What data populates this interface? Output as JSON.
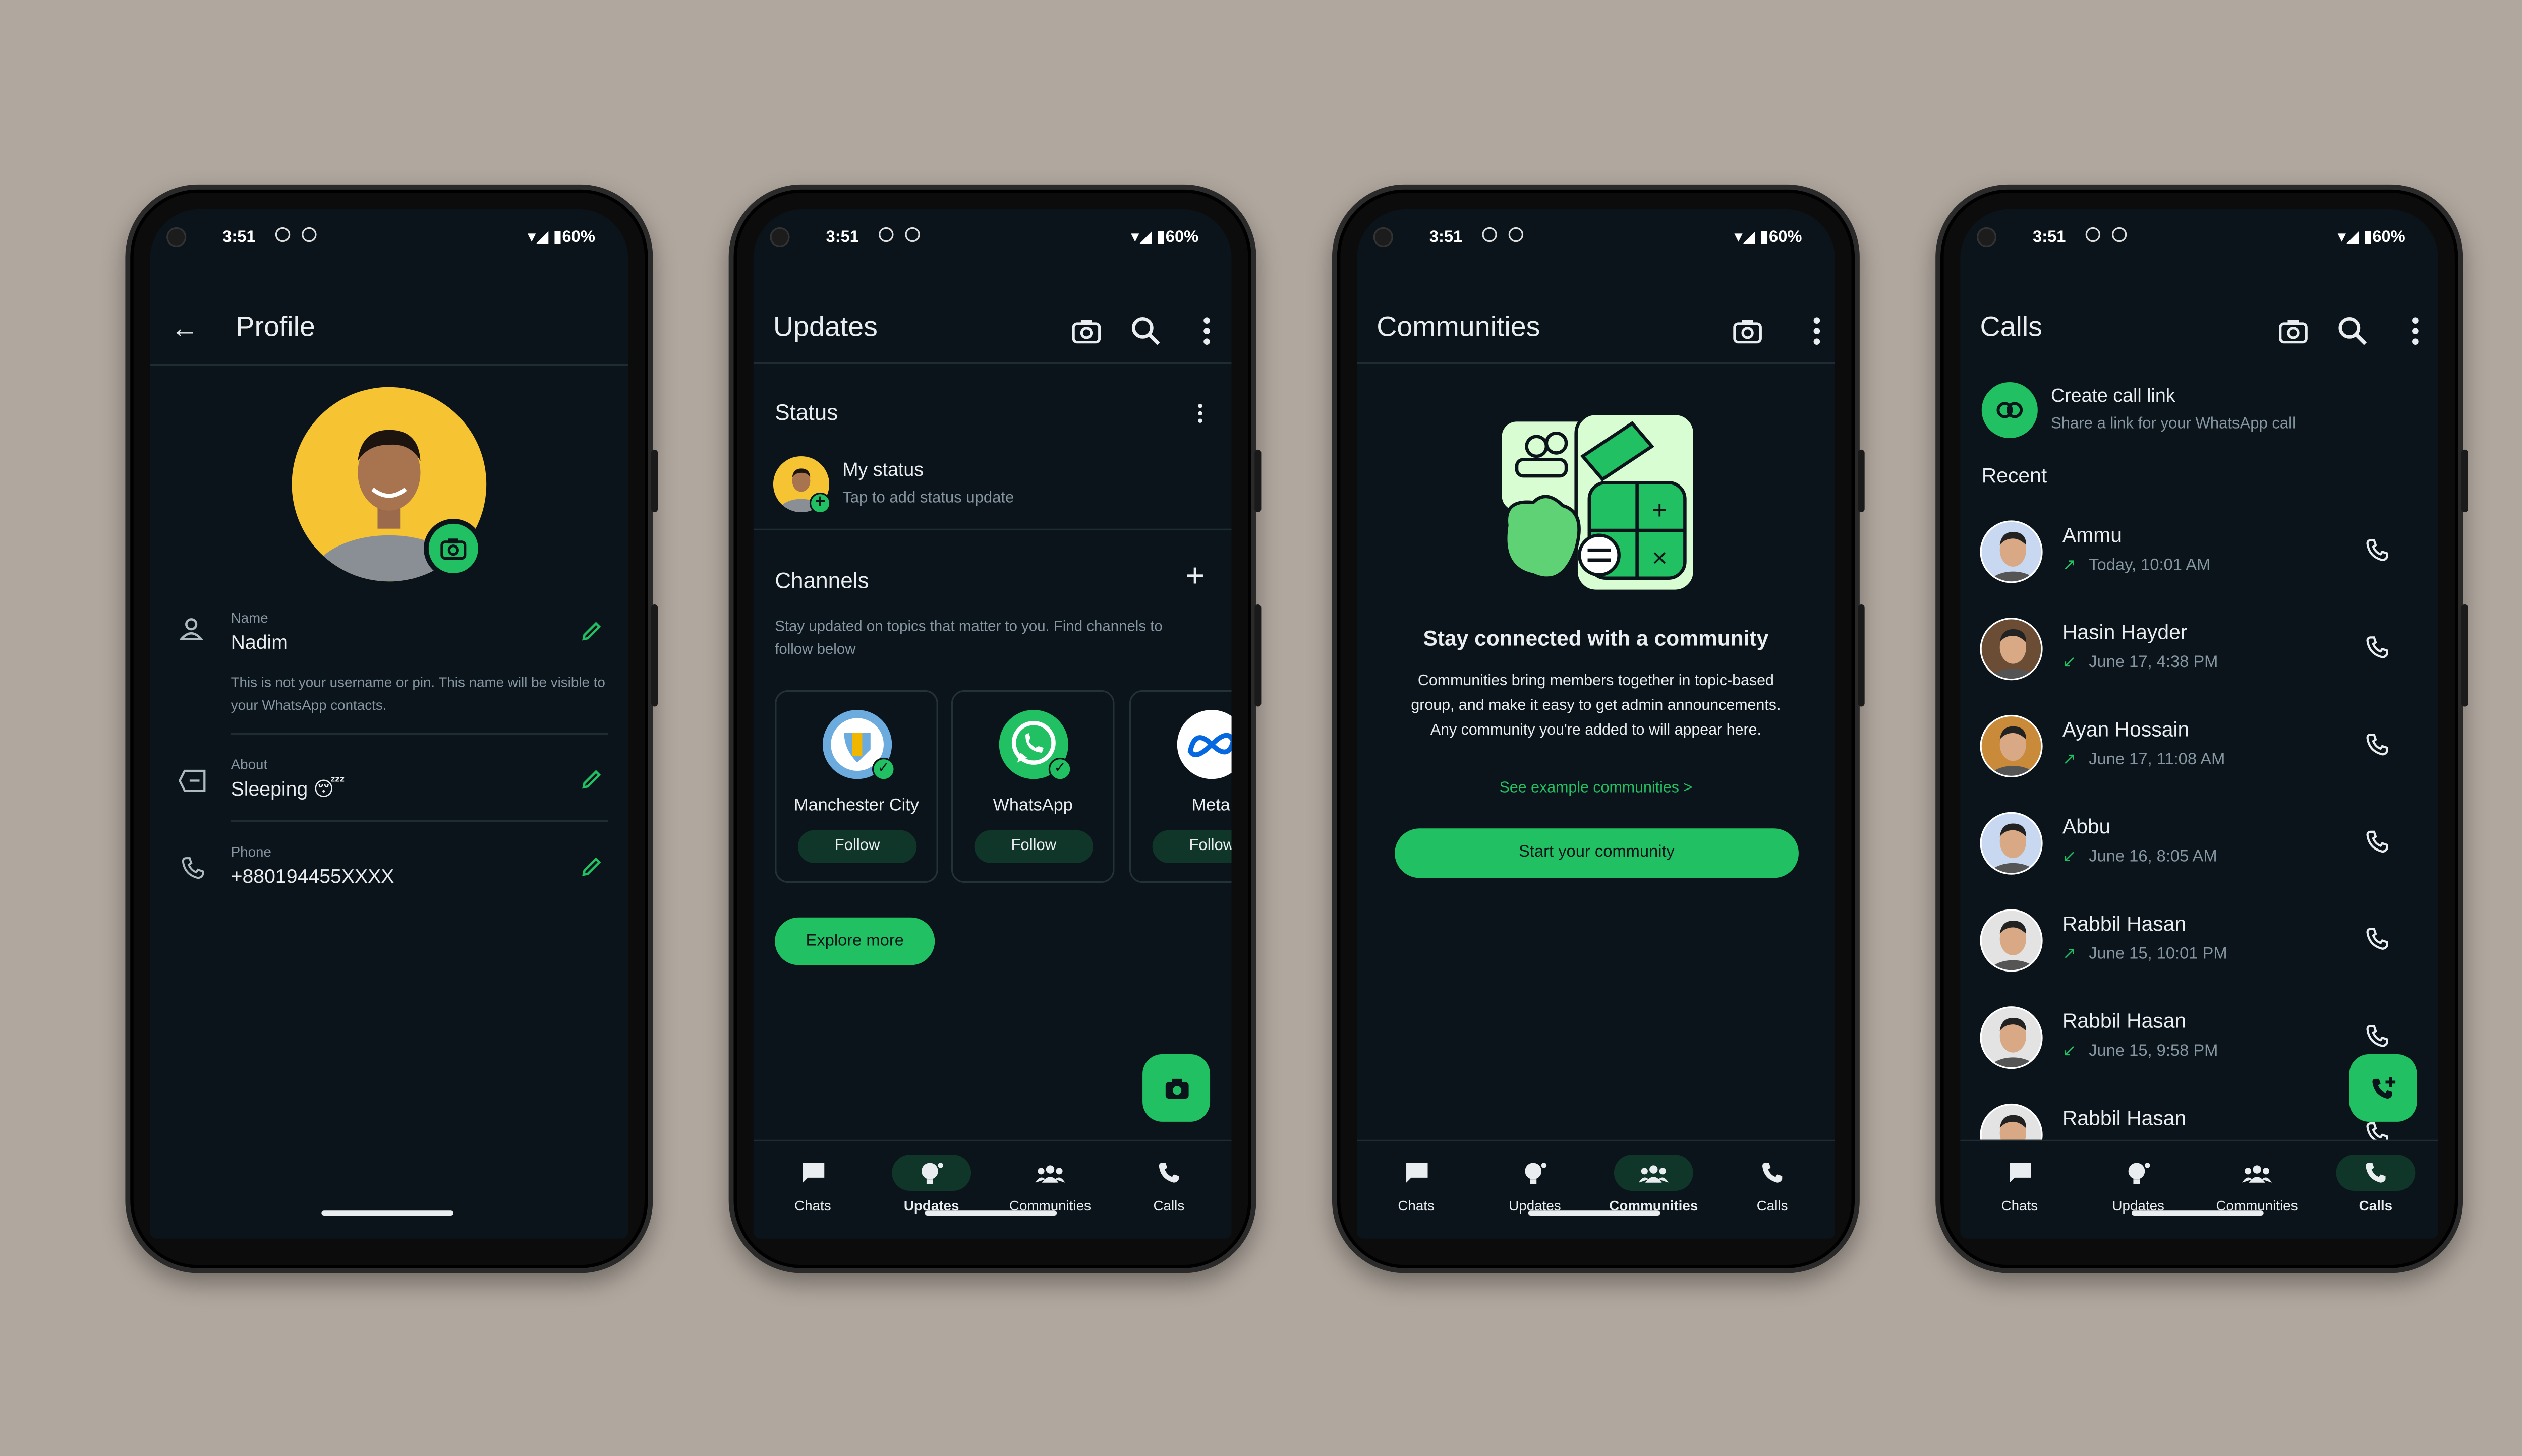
{
  "status": {
    "time": "3:51",
    "battery": "60%"
  },
  "nav": [
    {
      "label": "Chats",
      "icon": "chat-icon"
    },
    {
      "label": "Updates",
      "icon": "updates-icon"
    },
    {
      "label": "Communities",
      "icon": "communities-icon"
    },
    {
      "label": "Calls",
      "icon": "phone-icon"
    }
  ],
  "profile": {
    "title": "Profile",
    "name_label": "Name",
    "name_value": "Nadim",
    "name_hint": "This is not your username or pin. This name will be visible to your WhatsApp contacts.",
    "about_label": "About",
    "about_value": "Sleeping 😴",
    "phone_label": "Phone",
    "phone_value": "+880194455XXXX"
  },
  "updates": {
    "title": "Updates",
    "status_heading": "Status",
    "my_status": "My status",
    "my_status_sub": "Tap to add status update",
    "channels_heading": "Channels",
    "channels_desc": "Stay updated on topics that matter to you. Find channels to follow below",
    "channels": [
      {
        "name": "Manchester City",
        "follow": "Follow"
      },
      {
        "name": "WhatsApp",
        "follow": "Follow"
      },
      {
        "name": "Meta",
        "follow": "Follow"
      }
    ],
    "explore": "Explore more"
  },
  "communities": {
    "title": "Communities",
    "heading": "Stay connected with a community",
    "desc": "Communities bring members together in topic-based group, and make it easy to get admin announcements. Any community you're added to will appear here.",
    "link": "See example communities >",
    "button": "Start your community"
  },
  "calls": {
    "title": "Calls",
    "create_title": "Create call link",
    "create_sub": "Share a link for your WhatsApp call",
    "recent": "Recent",
    "items": [
      {
        "name": "Ammu",
        "time": "Today, 10:01 AM",
        "dir": "out"
      },
      {
        "name": "Hasin Hayder",
        "time": "June 17, 4:38 PM",
        "dir": "in"
      },
      {
        "name": "Ayan Hossain",
        "time": "June 17, 11:08 AM",
        "dir": "out"
      },
      {
        "name": "Abbu",
        "time": "June 16, 8:05 AM",
        "dir": "in"
      },
      {
        "name": "Rabbil Hasan",
        "time": "June 15, 10:01 PM",
        "dir": "out"
      },
      {
        "name": "Rabbil Hasan",
        "time": "June 15, 9:58 PM",
        "dir": "in"
      },
      {
        "name": "Rabbil Hasan",
        "time": "",
        "dir": "in"
      }
    ]
  },
  "colors": {
    "accent": "#21c063",
    "background": "#0b141a",
    "page": "#b0a79e"
  }
}
